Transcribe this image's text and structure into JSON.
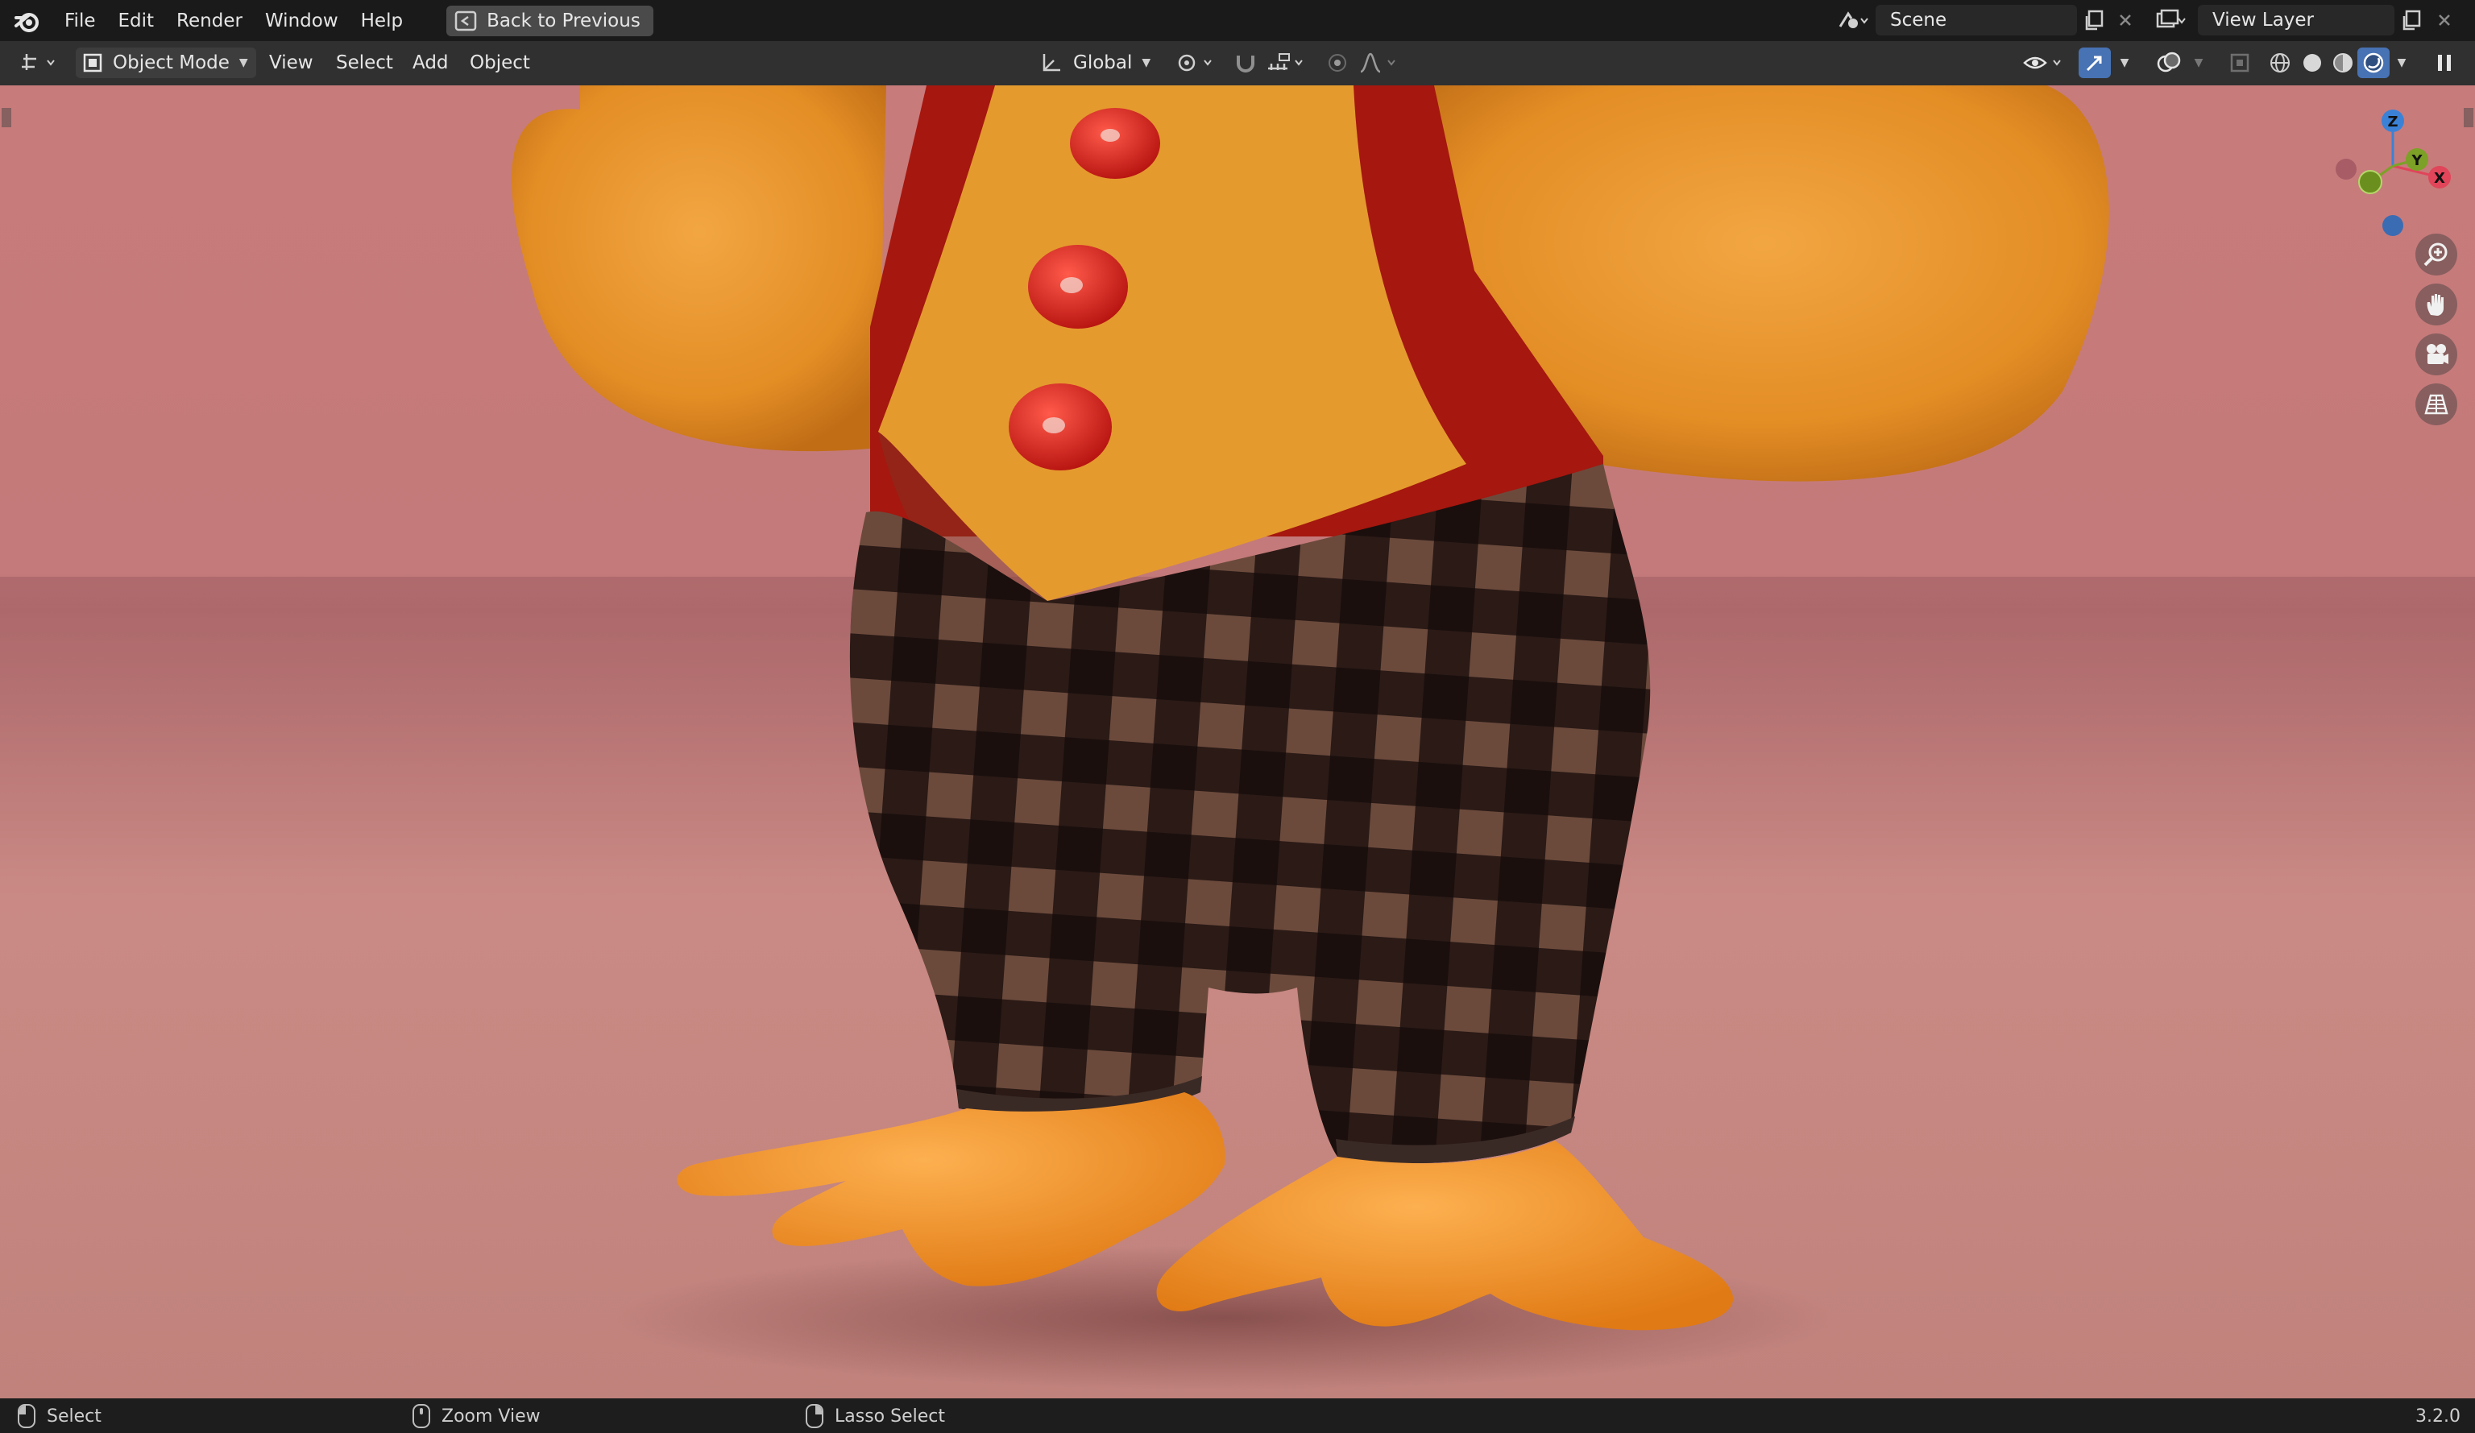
{
  "app": {
    "logo": "blender-logo-icon",
    "menus": [
      "File",
      "Edit",
      "Render",
      "Window",
      "Help"
    ],
    "back_button": "Back to Previous",
    "scene": "Scene",
    "view_layer": "View Layer"
  },
  "header": {
    "editor_type_icon": "3d-viewport-icon",
    "mode": "Object Mode",
    "menus": [
      "View",
      "Select",
      "Add",
      "Object"
    ],
    "transform_orientation": "Global",
    "pivot_icon": "pivot-point-icon",
    "snap_icon": "magnet-snap-icon",
    "proportional_icon": "proportional-edit-icon"
  },
  "viewport": {
    "content": "3D render preview: lower body of a fuzzy orange cartoon bird wearing a red/orange vest with three red buttons and black-brown plaid trousers, orange webbed feet, on a pink floor with pink background",
    "gizmo": {
      "x": "X",
      "y": "Y",
      "z": "Z"
    },
    "shading_active": "rendered",
    "accent_colors": {
      "x_axis": "#e0455a",
      "y_axis": "#7ca126",
      "z_axis": "#3b82d6",
      "selection": "#4772b3"
    }
  },
  "statusbar": {
    "left": "Select",
    "middle": "Zoom View",
    "right_action": "Lasso Select",
    "version": "3.2.0"
  }
}
